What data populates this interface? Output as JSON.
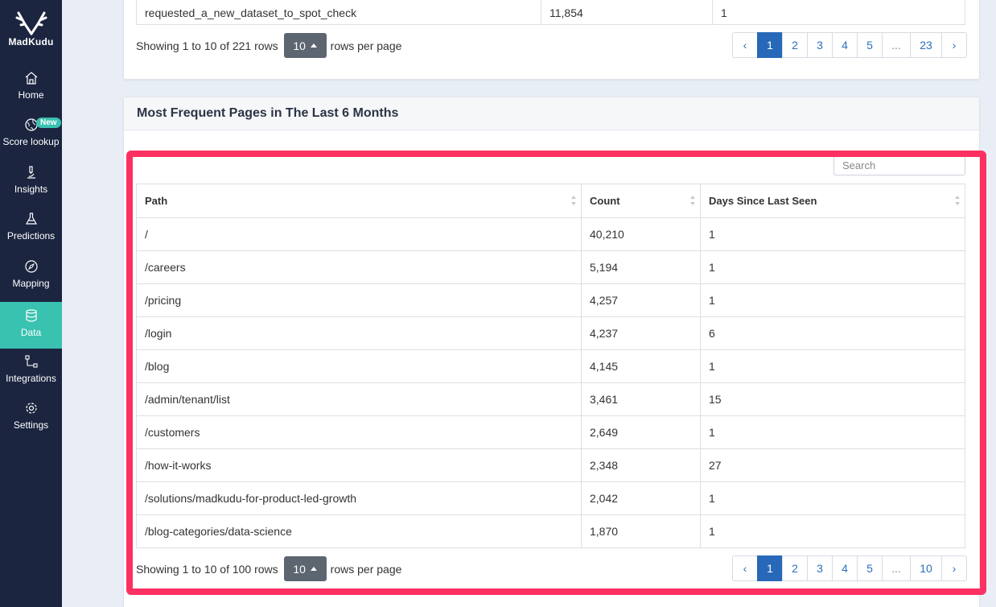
{
  "app": {
    "logo_text": "MadKudu",
    "accent_color": "#39c2b0",
    "sidebar_color": "#1b2540",
    "highlight_color": "#fc3162"
  },
  "sidebar": {
    "items": [
      {
        "label": "Home",
        "icon": "home-icon"
      },
      {
        "label": "Score lookup",
        "icon": "globe-icon",
        "badge": "New"
      },
      {
        "label": "Insights",
        "icon": "microscope-icon"
      },
      {
        "label": "Predictions",
        "icon": "flask-icon"
      },
      {
        "label": "Mapping",
        "icon": "compass-icon"
      },
      {
        "label": "Data",
        "icon": "database-icon",
        "active": true
      },
      {
        "label": "Integrations",
        "icon": "nodes-icon"
      },
      {
        "label": "Settings",
        "icon": "gear-icon"
      }
    ]
  },
  "top_table": {
    "last_row": [
      "requested_a_new_dataset_to_spot_check",
      "11,854",
      "1"
    ],
    "footer": {
      "showing": "Showing 1 to 10 of 221 rows",
      "rows_per_page_value": "10",
      "rows_per_page_label": "rows per page"
    },
    "pager": [
      "‹",
      "1",
      "2",
      "3",
      "4",
      "5",
      "...",
      "23",
      "›"
    ]
  },
  "pages_card": {
    "title": "Most Frequent Pages in The Last 6 Months",
    "search_placeholder": "Search",
    "columns": [
      "Path",
      "Count",
      "Days Since Last Seen"
    ],
    "rows": [
      [
        "/",
        "40,210",
        "1"
      ],
      [
        "/careers",
        "5,194",
        "1"
      ],
      [
        "/pricing",
        "4,257",
        "1"
      ],
      [
        "/login",
        "4,237",
        "6"
      ],
      [
        "/blog",
        "4,145",
        "1"
      ],
      [
        "/admin/tenant/list",
        "3,461",
        "15"
      ],
      [
        "/customers",
        "2,649",
        "1"
      ],
      [
        "/how-it-works",
        "2,348",
        "27"
      ],
      [
        "/solutions/madkudu-for-product-led-growth",
        "2,042",
        "1"
      ],
      [
        "/blog-categories/data-science",
        "1,870",
        "1"
      ]
    ],
    "footer": {
      "showing": "Showing 1 to 10 of 100 rows",
      "rows_per_page_value": "10",
      "rows_per_page_label": "rows per page"
    },
    "pager": [
      "‹",
      "1",
      "2",
      "3",
      "4",
      "5",
      "...",
      "10",
      "›"
    ]
  }
}
